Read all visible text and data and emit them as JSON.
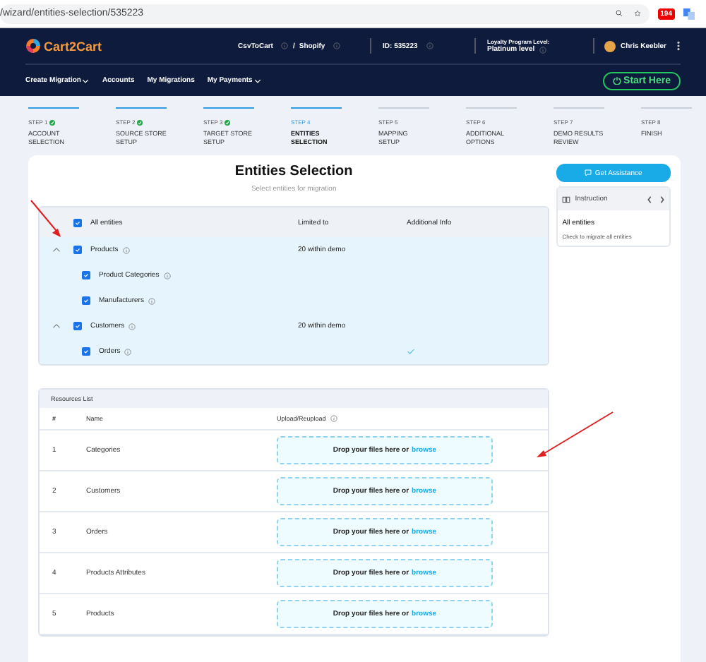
{
  "browser": {
    "url": "/wizard/entities-selection/535223",
    "badge": "194"
  },
  "header": {
    "logo": "Cart2Cart",
    "platforms": [
      {
        "name": "CsvToCart"
      },
      {
        "name": "Shopify"
      }
    ],
    "platform_separator": "/",
    "id": "ID: 535223",
    "loyalty_label": "Loyalty Program Level:",
    "loyalty_level": "Platinum level",
    "user": "Chris Keebler"
  },
  "nav": [
    {
      "label": "Create Migration",
      "dropdown": true
    },
    {
      "label": "Accounts",
      "dropdown": false
    },
    {
      "label": "My Migrations",
      "dropdown": false
    },
    {
      "label": "My Payments",
      "dropdown": true
    }
  ],
  "start_button": "Start Here",
  "steps": [
    {
      "step": "STEP 1",
      "title": "ACCOUNT SELECTION",
      "done": true,
      "selected": false
    },
    {
      "step": "STEP 2",
      "title": "SOURCE STORE SETUP",
      "done": true,
      "selected": false
    },
    {
      "step": "STEP 3",
      "title": "TARGET STORE SETUP",
      "done": true,
      "selected": false
    },
    {
      "step": "STEP 4",
      "title": "ENTITIES SELECTION",
      "done": false,
      "selected": true
    },
    {
      "step": "STEP 5",
      "title": "MAPPING SETUP",
      "done": false,
      "selected": false
    },
    {
      "step": "STEP 6",
      "title": "ADDITIONAL OPTIONS",
      "done": false,
      "selected": false
    },
    {
      "step": "STEP 7",
      "title": "DEMO RESULTS REVIEW",
      "done": false,
      "selected": false
    },
    {
      "step": "STEP 8",
      "title": "FINISH",
      "done": false,
      "selected": false
    }
  ],
  "title": "Entities Selection",
  "subtitle": "Select entities for migration",
  "entities": {
    "all_label": "All entities",
    "all_checked": true,
    "columns": [
      "Limited to",
      "Additional Info"
    ],
    "items": [
      {
        "name": "Products",
        "checked": true,
        "expanded": true,
        "limit": "20 within demo",
        "children": [
          {
            "name": "Product Categories",
            "checked": true,
            "ok": false
          },
          {
            "name": "Manufacturers",
            "checked": true,
            "ok": false
          }
        ]
      },
      {
        "name": "Customers",
        "checked": true,
        "expanded": true,
        "limit": "20 within demo",
        "children": [
          {
            "name": "Orders",
            "checked": true,
            "ok": true
          }
        ]
      }
    ]
  },
  "assist_button": "Get Assistance",
  "instruction": {
    "title": "Instruction",
    "heading": "All entities",
    "text": "Check to migrate all entities"
  },
  "resources": {
    "title": "Resources List",
    "columns": [
      "#",
      "Name",
      "Upload/Reupload"
    ],
    "rows": [
      {
        "n": "1",
        "name": "Categories",
        "drop_text": "Drop your files here or",
        "browse": "browse"
      },
      {
        "n": "2",
        "name": "Customers",
        "drop_text": "Drop your files here or",
        "browse": "browse"
      },
      {
        "n": "3",
        "name": "Orders",
        "drop_text": "Drop your files here or",
        "browse": "browse"
      },
      {
        "n": "4",
        "name": "Products Attributes",
        "drop_text": "Drop your files here or",
        "browse": "browse"
      },
      {
        "n": "5",
        "name": "Products",
        "drop_text": "Drop your files here or",
        "browse": "browse"
      }
    ]
  }
}
